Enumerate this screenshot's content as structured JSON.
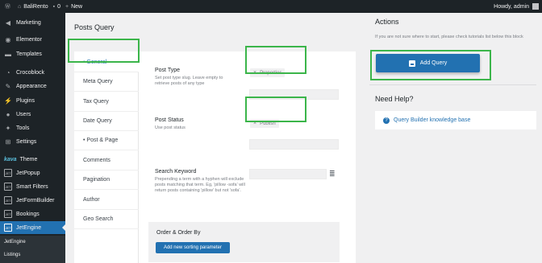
{
  "adminbar": {
    "site_name": "BaliRento",
    "comments_count": "0",
    "new_label": "New",
    "howdy": "Howdy, admin"
  },
  "sidebar": {
    "items": [
      {
        "label": "Marketing",
        "icon": "megaphone-icon"
      },
      {
        "label": "Elementor",
        "icon": "elementor-icon"
      },
      {
        "label": "Templates",
        "icon": "folder-icon"
      },
      {
        "label": "Crocoblock",
        "icon": "crocoblock-icon"
      },
      {
        "label": "Appearance",
        "icon": "brush-icon"
      },
      {
        "label": "Plugins",
        "icon": "plugin-icon"
      },
      {
        "label": "Users",
        "icon": "users-icon"
      },
      {
        "label": "Tools",
        "icon": "wrench-icon"
      },
      {
        "label": "Settings",
        "icon": "settings-icon"
      },
      {
        "label": "Theme",
        "icon": "kava-logo",
        "logo_text": "kava"
      },
      {
        "label": "JetPopup",
        "icon": "jet-icon"
      },
      {
        "label": "Smart Filters",
        "icon": "jet-icon"
      },
      {
        "label": "JetFormBuilder",
        "icon": "jet-icon"
      },
      {
        "label": "Bookings",
        "icon": "jet-icon"
      },
      {
        "label": "JetEngine",
        "icon": "jet-icon"
      }
    ],
    "jet_badge": "JET",
    "submenu": [
      "JetEngine",
      "Listings"
    ]
  },
  "main": {
    "title": "Posts Query",
    "tabs": [
      {
        "label": "• General",
        "active": true
      },
      {
        "label": "Meta Query"
      },
      {
        "label": "Tax Query"
      },
      {
        "label": "Date Query"
      },
      {
        "label": "• Post & Page"
      },
      {
        "label": "Comments"
      },
      {
        "label": "Pagination"
      },
      {
        "label": "Author"
      },
      {
        "label": "Geo Search"
      }
    ],
    "fields": {
      "post_type": {
        "label": "Post Type",
        "desc": "Set post type slug. Leave empty to retrieve posts of any type",
        "chip": "Properties"
      },
      "post_status": {
        "label": "Post Status",
        "desc": "Use post status",
        "chip": "Publish"
      },
      "search_keyword": {
        "label": "Search Keyword",
        "desc": "Prepending a term with a hyphen will exclude posts matching that term. Eg, 'pillow -sofa' will return posts containing 'pillow' but not 'sofa'.",
        "value": ""
      }
    },
    "order": {
      "label": "Order & Order By",
      "button": "Add new sorting parameter"
    }
  },
  "right": {
    "actions_title": "Actions",
    "actions_desc": "If you are not sure where to start, please check tutorials list below this block",
    "add_button": "Add Query",
    "help_title": "Need Help?",
    "help_link": "Query Builder knowledge base"
  },
  "colors": {
    "accent": "#2271b1",
    "highlight": "#3bb54a",
    "admin_dark": "#1d2327"
  }
}
